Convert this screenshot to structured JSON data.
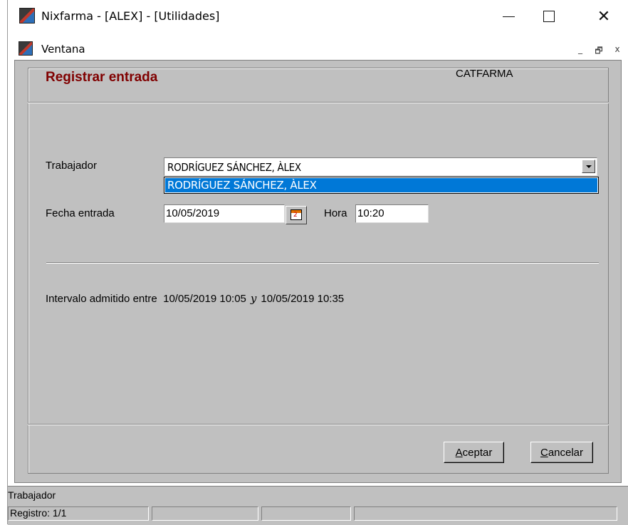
{
  "window": {
    "title": "Nixfarma - [ALEX] - [Utilidades]"
  },
  "menubar": {
    "ventana_label": "Ventana",
    "mdi_min": "_",
    "mdi_restore": "🗗",
    "mdi_close": "x"
  },
  "form": {
    "heading": "Registrar entrada",
    "company": "CATFARMA",
    "trabajador_label": "Trabajador",
    "trabajador_value": "RODRÍGUEZ SÁNCHEZ, ÀLEX",
    "dropdown_options": [
      "RODRÍGUEZ SÁNCHEZ, ÀLEX"
    ],
    "fecha_label": "Fecha entrada",
    "fecha_value": "10/05/2019",
    "hora_label": "Hora",
    "hora_value": "10:20",
    "interval_prefix": "Intervalo admitido entre",
    "interval_from": "10/05/2019 10:05",
    "interval_and": "y",
    "interval_to": "10/05/2019 10:35",
    "accept_label": "Aceptar",
    "accept_hotkey": "A",
    "accept_rest": "ceptar",
    "cancel_label": "Cancelar",
    "cancel_hotkey": "C",
    "cancel_rest": "ancelar"
  },
  "statusbar": {
    "field_name": "Trabajador",
    "record": "Registro: 1/1",
    "panel2": "",
    "panel3": "",
    "panel4": ""
  },
  "icons": {
    "app": "nixfarma-app-icon",
    "calendar": "calendar-icon",
    "dropdown": "chevron-down-icon"
  }
}
